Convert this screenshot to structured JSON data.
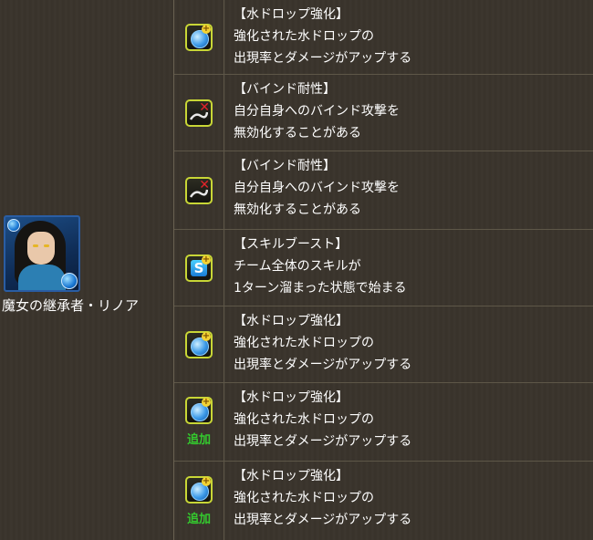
{
  "character": {
    "name": "魔女の継承者・リノア",
    "portrait": "linoa-portrait",
    "attribute_color": "#1a78d4"
  },
  "awakenings": [
    {
      "icon": "water-drop-enhance-icon",
      "title": "【水ドロップ強化】",
      "line1": "強化された水ドロップの",
      "line2": "出現率とダメージがアップする",
      "added": ""
    },
    {
      "icon": "bind-resist-icon",
      "title": "【バインド耐性】",
      "line1": "自分自身へのバインド攻撃を",
      "line2": "無効化することがある",
      "added": ""
    },
    {
      "icon": "bind-resist-icon",
      "title": "【バインド耐性】",
      "line1": "自分自身へのバインド攻撃を",
      "line2": "無効化することがある",
      "added": ""
    },
    {
      "icon": "skill-boost-icon",
      "title": "【スキルブースト】",
      "line1": "チーム全体のスキルが",
      "line2": "1ターン溜まった状態で始まる",
      "added": ""
    },
    {
      "icon": "water-drop-enhance-icon",
      "title": "【水ドロップ強化】",
      "line1": "強化された水ドロップの",
      "line2": "出現率とダメージがアップする",
      "added": ""
    },
    {
      "icon": "water-drop-enhance-icon",
      "title": "【水ドロップ強化】",
      "line1": "強化された水ドロップの",
      "line2": "出現率とダメージがアップする",
      "added": "追加"
    },
    {
      "icon": "water-drop-enhance-icon",
      "title": "【水ドロップ強化】",
      "line1": "強化された水ドロップの",
      "line2": "出現率とダメージがアップする",
      "added": "追加"
    }
  ],
  "colors": {
    "added": "#34c92e",
    "icon_border": "#c8d636"
  }
}
